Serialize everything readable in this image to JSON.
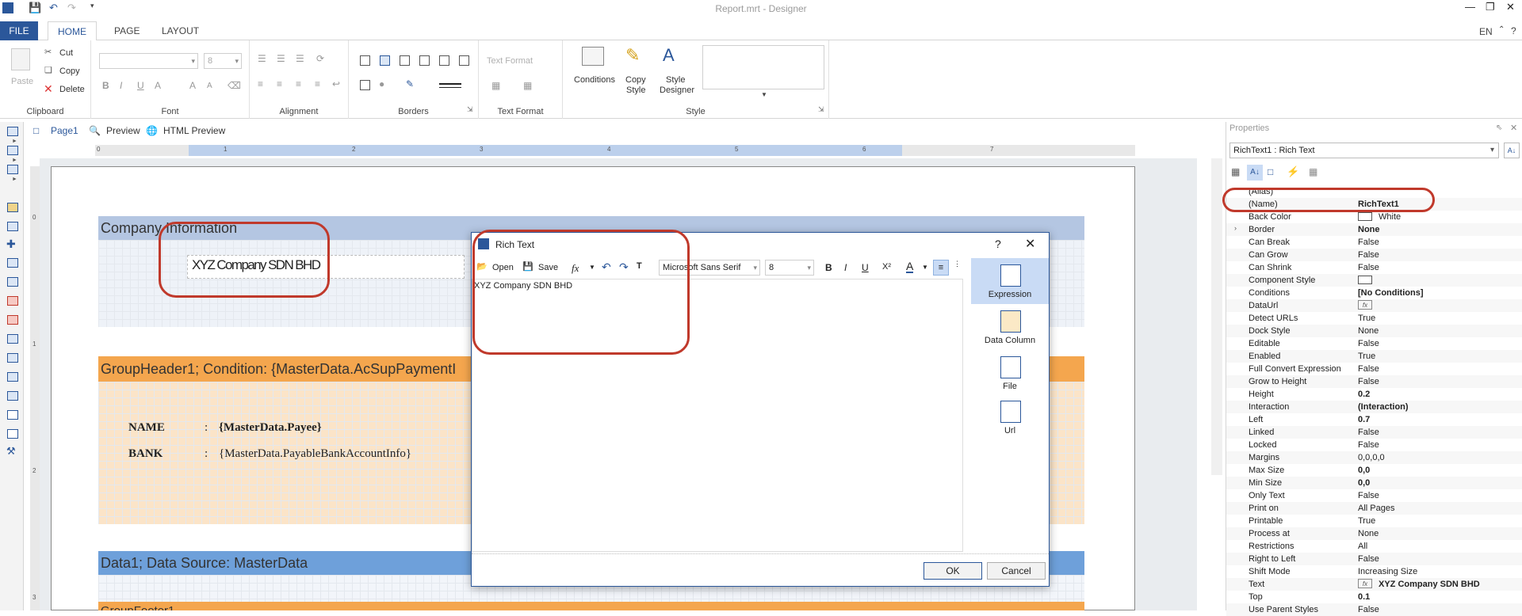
{
  "window": {
    "title": "Report.mrt - Designer",
    "lang": "EN",
    "help": "?"
  },
  "tabs": [
    {
      "label": "FILE"
    },
    {
      "label": "HOME"
    },
    {
      "label": "PAGE"
    },
    {
      "label": "LAYOUT"
    }
  ],
  "ribbon": {
    "clipboard": {
      "paste": "Paste",
      "cut": "Cut",
      "copy": "Copy",
      "delete": "Delete",
      "label": "Clipboard"
    },
    "font": {
      "size": "8",
      "label": "Font"
    },
    "alignment": {
      "label": "Alignment"
    },
    "borders": {
      "label": "Borders"
    },
    "text_format": {
      "combo": "Text Format",
      "label": "Text Format"
    },
    "style": {
      "conditions": "Conditions",
      "copy_style_1": "Copy",
      "copy_style_2": "Style",
      "style_designer_1": "Style",
      "style_designer_2": "Designer",
      "label": "Style"
    }
  },
  "page_tabs": {
    "page1": "Page1",
    "preview": "Preview",
    "html_preview": "HTML Preview"
  },
  "ruler": {
    "h": [
      "0",
      "1",
      "2",
      "3",
      "4",
      "5",
      "6",
      "7"
    ],
    "v": [
      "0",
      "1",
      "2",
      "3"
    ]
  },
  "canvas": {
    "company_band": "Company Information",
    "company_text": "XYZ Company SDN BHD",
    "group_header": "GroupHeader1; Condition: {MasterData.AcSupPaymentI",
    "name_label": "NAME",
    "bank_label": "BANK",
    "colon": ":",
    "payee": "{MasterData.Payee}",
    "bank_info": "{MasterData.PayableBankAccountInfo}",
    "data_band": "Data1; Data Source: MasterData",
    "footer_band": "GroupFooter1"
  },
  "dialog": {
    "title": "Rich Text",
    "help": "?",
    "open": "Open",
    "save": "Save",
    "fx": "fx",
    "font": "Microsoft Sans Serif",
    "size": "8",
    "bold": "B",
    "italic": "I",
    "underline": "U",
    "superscript": "X²",
    "text": "XYZ Company SDN BHD",
    "side": [
      {
        "label": "Expression"
      },
      {
        "label": "Data Column"
      },
      {
        "label": "File"
      },
      {
        "label": "Url"
      }
    ],
    "ok": "OK",
    "cancel": "Cancel"
  },
  "properties": {
    "title": "Properties",
    "selected": "RichText1 : Rich Text",
    "rows": [
      {
        "name": "(Alias)",
        "value": ""
      },
      {
        "name": "(Name)",
        "value": "RichText1",
        "bold": true
      },
      {
        "name": "Back Color",
        "value": "White"
      },
      {
        "name": "Border",
        "value": "None",
        "bold": true
      },
      {
        "name": "Can Break",
        "value": "False"
      },
      {
        "name": "Can Grow",
        "value": "False"
      },
      {
        "name": "Can Shrink",
        "value": "False"
      },
      {
        "name": "Component Style",
        "value": ""
      },
      {
        "name": "Conditions",
        "value": "[No Conditions]",
        "bold": true
      },
      {
        "name": "DataUrl",
        "value": ""
      },
      {
        "name": "Detect URLs",
        "value": "True"
      },
      {
        "name": "Dock Style",
        "value": "None"
      },
      {
        "name": "Editable",
        "value": "False"
      },
      {
        "name": "Enabled",
        "value": "True"
      },
      {
        "name": "Full Convert Expression",
        "value": "False"
      },
      {
        "name": "Grow to Height",
        "value": "False"
      },
      {
        "name": "Height",
        "value": "0.2",
        "bold": true
      },
      {
        "name": "Interaction",
        "value": "(Interaction)",
        "bold": true
      },
      {
        "name": "Left",
        "value": "0.7",
        "bold": true
      },
      {
        "name": "Linked",
        "value": "False"
      },
      {
        "name": "Locked",
        "value": "False"
      },
      {
        "name": "Margins",
        "value": "0,0,0,0"
      },
      {
        "name": "Max Size",
        "value": "0,0",
        "bold": true
      },
      {
        "name": "Min Size",
        "value": "0,0",
        "bold": true
      },
      {
        "name": "Only Text",
        "value": "False"
      },
      {
        "name": "Print on",
        "value": "All Pages"
      },
      {
        "name": "Printable",
        "value": "True"
      },
      {
        "name": "Process at",
        "value": "None"
      },
      {
        "name": "Restrictions",
        "value": "All"
      },
      {
        "name": "Right to Left",
        "value": "False"
      },
      {
        "name": "Shift Mode",
        "value": "Increasing Size"
      },
      {
        "name": "Text",
        "value": "XYZ Company SDN BHD",
        "bold": true
      },
      {
        "name": "Top",
        "value": "0.1",
        "bold": true
      },
      {
        "name": "Use Parent Styles",
        "value": "False"
      }
    ]
  },
  "colors": {
    "accent": "#2b579a",
    "highlight": "#c0392b",
    "group_header": "#f4a64e",
    "data_band": "#6ea0da"
  }
}
